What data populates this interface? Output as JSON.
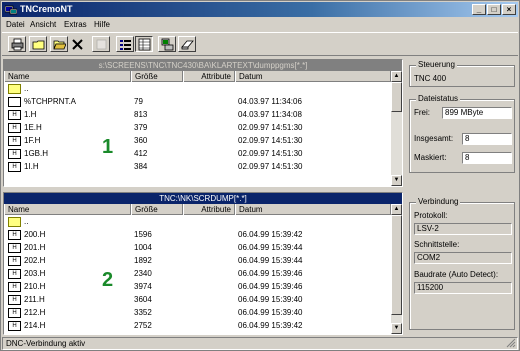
{
  "window": {
    "title": "TNCremoNT"
  },
  "menu": [
    "Datei",
    "Ansicht",
    "Extras",
    "Hilfe"
  ],
  "toolbar_icons": [
    "print-icon",
    "folder-new-icon",
    "folder-open-icon",
    "delete-icon",
    "blank-icon",
    "list-view-icon",
    "detail-view-icon",
    "tnc-icon",
    "eraser-icon"
  ],
  "panel1": {
    "path": "s:\\SCREENS\\TNC\\TNC430\\BA\\KLARTEXT\\dumppgms[*.*]",
    "columns": [
      "Name",
      "Größe",
      "Attribute",
      "Datum"
    ],
    "rows": [
      {
        "icon": "folder",
        "name": "..",
        "size": "",
        "attr": "",
        "date": ""
      },
      {
        "icon": "doc",
        "name": "%TCHPRNT.A",
        "size": "79",
        "attr": "",
        "date": "04.03.97 11:34:06"
      },
      {
        "icon": "h",
        "name": "1.H",
        "size": "813",
        "attr": "",
        "date": "04.03.97 11:34:08"
      },
      {
        "icon": "h",
        "name": "1E.H",
        "size": "379",
        "attr": "",
        "date": "02.09.97 14:51:30"
      },
      {
        "icon": "h",
        "name": "1F.H",
        "size": "360",
        "attr": "",
        "date": "02.09.97 14:51:30"
      },
      {
        "icon": "h",
        "name": "1GB.H",
        "size": "412",
        "attr": "",
        "date": "02.09.97 14:51:30"
      },
      {
        "icon": "h",
        "name": "1I.H",
        "size": "384",
        "attr": "",
        "date": "02.09.97 14:51:30"
      }
    ],
    "marker": "1"
  },
  "panel2": {
    "path": "TNC:\\NK\\SCRDUMP[*.*]",
    "columns": [
      "Name",
      "Größe",
      "Attribute",
      "Datum"
    ],
    "rows": [
      {
        "icon": "folder",
        "name": "..",
        "size": "",
        "attr": "",
        "date": ""
      },
      {
        "icon": "h",
        "name": "200.H",
        "size": "1596",
        "attr": "",
        "date": "06.04.99 15:39:42"
      },
      {
        "icon": "h",
        "name": "201.H",
        "size": "1004",
        "attr": "",
        "date": "06.04.99 15:39:44"
      },
      {
        "icon": "h",
        "name": "202.H",
        "size": "1892",
        "attr": "",
        "date": "06.04.99 15:39:44"
      },
      {
        "icon": "h",
        "name": "203.H",
        "size": "2340",
        "attr": "",
        "date": "06.04.99 15:39:46"
      },
      {
        "icon": "h",
        "name": "210.H",
        "size": "3974",
        "attr": "",
        "date": "06.04.99 15:39:46"
      },
      {
        "icon": "h",
        "name": "211.H",
        "size": "3604",
        "attr": "",
        "date": "06.04.99 15:39:40"
      },
      {
        "icon": "h",
        "name": "212.H",
        "size": "3352",
        "attr": "",
        "date": "06.04.99 15:39:40"
      },
      {
        "icon": "h",
        "name": "214.H",
        "size": "2752",
        "attr": "",
        "date": "06.04.99 15:39:42"
      }
    ],
    "marker": "2"
  },
  "steuerung": {
    "title": "Steuerung",
    "value": "TNC 400"
  },
  "dateistatus": {
    "title": "Dateistatus",
    "frei_label": "Frei:",
    "frei_value": "899 MByte",
    "insgesamt_label": "Insgesamt:",
    "insgesamt_value": "8",
    "maskiert_label": "Maskiert:",
    "maskiert_value": "8"
  },
  "verbindung": {
    "title": "Verbindung",
    "protokoll_label": "Protokoll:",
    "protokoll_value": "LSV-2",
    "schnittstelle_label": "Schnittstelle:",
    "schnittstelle_value": "COM2",
    "baudrate_label": "Baudrate (Auto Detect):",
    "baudrate_value": "115200"
  },
  "status": "DNC-Verbindung aktiv",
  "colors": {
    "title_start": "#0a246a",
    "title_end": "#a6caf0",
    "marker": "#1a8a2a"
  }
}
